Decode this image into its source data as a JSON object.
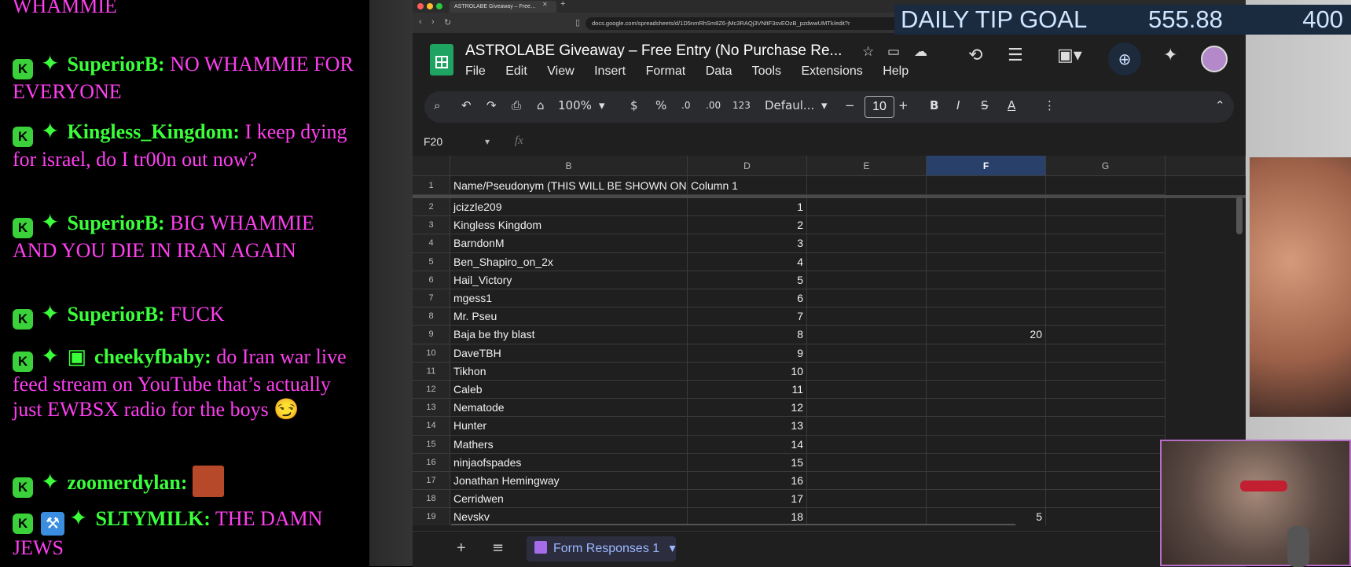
{
  "chat": {
    "partial_top": "WHAMMIE",
    "messages": [
      {
        "user": "SuperiorB:",
        "text": "NO WHAMMIE FOR EVERYONE"
      },
      {
        "user": "Kingless_Kingdom:",
        "text": "I keep dying for israel, do I tr00n out now?"
      },
      {
        "user": "SuperiorB:",
        "text": "BIG WHAMMIE AND YOU DIE IN IRAN AGAIN"
      },
      {
        "user": "SuperiorB:",
        "text": "FUCK"
      },
      {
        "user": "cheekyfbaby:",
        "text": "do Iran war live feed stream on YouTube that’s actually just EWBSX radio for the boys 😏"
      },
      {
        "user": "zoomerdylan:",
        "text": ""
      },
      {
        "user": "SLTYMILK:",
        "text": "THE DAMN JEWS"
      }
    ],
    "badge_letter": "K"
  },
  "browser": {
    "tab_title": "ASTROLABE Giveaway – Free…",
    "url": "docs.google.com/spreadsheets/d/1D5nmRhSm8Z6-jMc3RAQj3VNltF3svEOzB_pzdwwUMTk/edit?r"
  },
  "sheets": {
    "title": "ASTROLABE Giveaway – Free Entry (No Purchase Re...",
    "menu": [
      "File",
      "Edit",
      "View",
      "Insert",
      "Format",
      "Data",
      "Tools",
      "Extensions",
      "Help"
    ],
    "zoom": "100%",
    "currency": "$",
    "percent": "%",
    "dec_decrease": ".0",
    "dec_increase": ".00",
    "number_format": "123",
    "font": "Defaul...",
    "font_size": "10",
    "name_box": "F20",
    "fx": "fx",
    "columns": [
      "B",
      "D",
      "E",
      "F",
      "G"
    ],
    "selected_column": "F",
    "header_row": {
      "num": "1",
      "B": "Name/Pseudonym (THIS WILL BE SHOWN ON-S",
      "D": "Column 1"
    },
    "rows": [
      {
        "num": "2",
        "B": "jcizzle209",
        "D": "1",
        "F": ""
      },
      {
        "num": "3",
        "B": "Kingless Kingdom",
        "D": "2",
        "F": ""
      },
      {
        "num": "4",
        "B": "BarndonM",
        "D": "3",
        "F": ""
      },
      {
        "num": "5",
        "B": "Ben_Shapiro_on_2x",
        "D": "4",
        "F": ""
      },
      {
        "num": "6",
        "B": "Hail_Victory",
        "D": "5",
        "F": ""
      },
      {
        "num": "7",
        "B": "mgess1",
        "D": "6",
        "F": ""
      },
      {
        "num": "8",
        "B": "Mr. Pseu",
        "D": "7",
        "F": ""
      },
      {
        "num": "9",
        "B": "Baja be thy blast",
        "D": "8",
        "F": "20"
      },
      {
        "num": "10",
        "B": "DaveTBH",
        "D": "9",
        "F": ""
      },
      {
        "num": "11",
        "B": "Tikhon",
        "D": "10",
        "F": ""
      },
      {
        "num": "12",
        "B": "Caleb",
        "D": "11",
        "F": ""
      },
      {
        "num": "13",
        "B": "Nematode",
        "D": "12",
        "F": ""
      },
      {
        "num": "14",
        "B": "Hunter",
        "D": "13",
        "F": ""
      },
      {
        "num": "15",
        "B": "Mathers",
        "D": "14",
        "F": ""
      },
      {
        "num": "16",
        "B": "ninjaofspades",
        "D": "15",
        "F": ""
      },
      {
        "num": "17",
        "B": "Jonathan Hemingway",
        "D": "16",
        "F": ""
      },
      {
        "num": "18",
        "B": "Cerridwen",
        "D": "17",
        "F": ""
      },
      {
        "num": "19",
        "B": "Nevskv",
        "D": "18",
        "F": "5"
      }
    ],
    "sheet_tab": "Form Responses 1"
  },
  "overlay": {
    "tip_label": "DAILY TIP GOAL",
    "tip_amount": "555.88",
    "tip_target": "400"
  },
  "colors": {
    "chat_text": "#ff3ff0",
    "chat_user": "#3aff3a",
    "sheets_green": "#1ea362",
    "selected_col": "#28406a"
  }
}
